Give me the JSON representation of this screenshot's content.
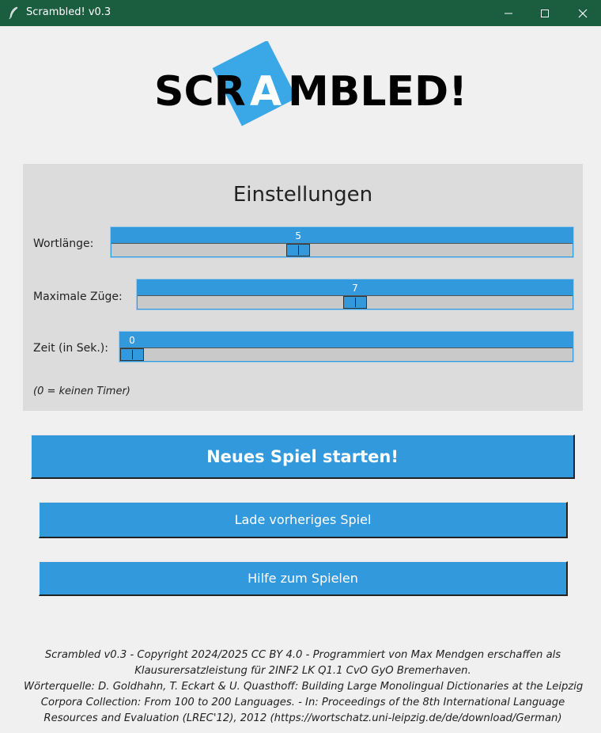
{
  "window": {
    "title": "Scrambled! v0.3",
    "icons": [
      "feather-icon",
      "minimize-icon",
      "maximize-icon",
      "close-icon"
    ]
  },
  "logo": {
    "text_left": "SCR",
    "text_tile": "A",
    "text_right": "MBLED!",
    "tile_color": "#3aa8e6"
  },
  "settings": {
    "title": "Einstellungen",
    "word_length": {
      "label": "Wortlänge:",
      "value": "5",
      "level": 0.4
    },
    "max_moves": {
      "label": "Maximale Züge:",
      "value": "7",
      "level": 0.5
    },
    "time": {
      "label": "Zeit (in Sek.):",
      "value": "0",
      "level": 0.0
    },
    "hint": "(0 = keinen Timer)"
  },
  "buttons": {
    "new_game": "Neues Spiel starten!",
    "load_game": "Lade vorheriges Spiel",
    "help": "Hilfe zum Spielen"
  },
  "footer": {
    "lines": [
      "Scrambled v0.3 - Copyright 2024/2025 CC BY 4.0 - Programmiert von Max Mendgen erschaffen als",
      "Klausurersatzleistung für 2INF2 LK Q1.1 CvO GyO Bremerhaven.",
      "Wörterquelle: D. Goldhahn, T. Eckart & U. Quasthoff: Building Large Monolingual Dictionaries at the Leipzig",
      "Corpora Collection: From 100 to 200 Languages. - In: Proceedings of the 8th International Language",
      "Resources and Evaluation (LREC'12), 2012 (https://wortschatz.uni-leipzig.de/de/download/German)"
    ]
  },
  "colors": {
    "titlebar": "#1b5e3f",
    "accent": "#3399dd",
    "panel": "#dcdcdc",
    "background": "#f0f0f0"
  }
}
